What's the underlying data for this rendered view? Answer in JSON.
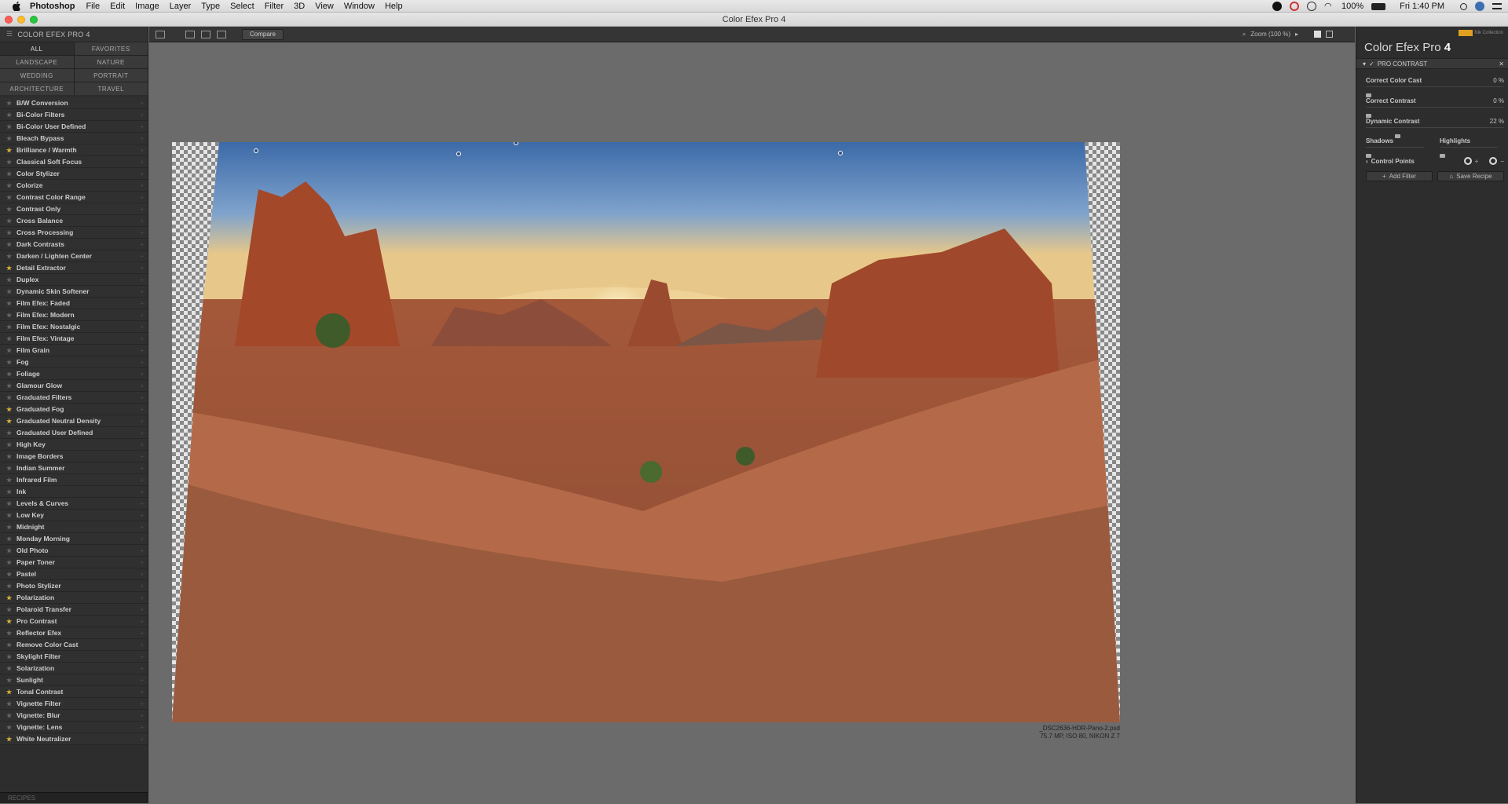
{
  "menubar": {
    "app_name": "Photoshop",
    "items": [
      "File",
      "Edit",
      "Image",
      "Layer",
      "Type",
      "Select",
      "Filter",
      "3D",
      "View",
      "Window",
      "Help"
    ],
    "battery": "100%",
    "clock": "Fri 1:40 PM"
  },
  "window": {
    "title": "Color Efex Pro 4"
  },
  "left_panel": {
    "title": "COLOR EFEX PRO 4",
    "categories": [
      "ALL",
      "FAVORITES",
      "LANDSCAPE",
      "NATURE",
      "WEDDING",
      "PORTRAIT",
      "ARCHITECTURE",
      "TRAVEL"
    ],
    "filters": [
      {
        "name": "B/W Conversion",
        "fav": false
      },
      {
        "name": "Bi-Color Filters",
        "fav": false
      },
      {
        "name": "Bi-Color User Defined",
        "fav": false
      },
      {
        "name": "Bleach Bypass",
        "fav": false
      },
      {
        "name": "Brilliance / Warmth",
        "fav": true
      },
      {
        "name": "Classical Soft Focus",
        "fav": false
      },
      {
        "name": "Color Stylizer",
        "fav": false
      },
      {
        "name": "Colorize",
        "fav": false
      },
      {
        "name": "Contrast Color Range",
        "fav": false
      },
      {
        "name": "Contrast Only",
        "fav": false
      },
      {
        "name": "Cross Balance",
        "fav": false
      },
      {
        "name": "Cross Processing",
        "fav": false
      },
      {
        "name": "Dark Contrasts",
        "fav": false
      },
      {
        "name": "Darken / Lighten Center",
        "fav": false
      },
      {
        "name": "Detail Extractor",
        "fav": true
      },
      {
        "name": "Duplex",
        "fav": false
      },
      {
        "name": "Dynamic Skin Softener",
        "fav": false
      },
      {
        "name": "Film Efex: Faded",
        "fav": false
      },
      {
        "name": "Film Efex: Modern",
        "fav": false
      },
      {
        "name": "Film Efex: Nostalgic",
        "fav": false
      },
      {
        "name": "Film Efex: Vintage",
        "fav": false
      },
      {
        "name": "Film Grain",
        "fav": false
      },
      {
        "name": "Fog",
        "fav": false
      },
      {
        "name": "Foliage",
        "fav": false
      },
      {
        "name": "Glamour Glow",
        "fav": false
      },
      {
        "name": "Graduated Filters",
        "fav": false
      },
      {
        "name": "Graduated Fog",
        "fav": true
      },
      {
        "name": "Graduated Neutral Density",
        "fav": true
      },
      {
        "name": "Graduated User Defined",
        "fav": false
      },
      {
        "name": "High Key",
        "fav": false
      },
      {
        "name": "Image Borders",
        "fav": false
      },
      {
        "name": "Indian Summer",
        "fav": false
      },
      {
        "name": "Infrared Film",
        "fav": false
      },
      {
        "name": "Ink",
        "fav": false
      },
      {
        "name": "Levels & Curves",
        "fav": false
      },
      {
        "name": "Low Key",
        "fav": false
      },
      {
        "name": "Midnight",
        "fav": false
      },
      {
        "name": "Monday Morning",
        "fav": false
      },
      {
        "name": "Old Photo",
        "fav": false
      },
      {
        "name": "Paper Toner",
        "fav": false
      },
      {
        "name": "Pastel",
        "fav": false
      },
      {
        "name": "Photo Stylizer",
        "fav": false
      },
      {
        "name": "Polarization",
        "fav": true
      },
      {
        "name": "Polaroid Transfer",
        "fav": false
      },
      {
        "name": "Pro Contrast",
        "fav": true
      },
      {
        "name": "Reflector Efex",
        "fav": false
      },
      {
        "name": "Remove Color Cast",
        "fav": false
      },
      {
        "name": "Skylight Filter",
        "fav": false
      },
      {
        "name": "Solarization",
        "fav": false
      },
      {
        "name": "Sunlight",
        "fav": false
      },
      {
        "name": "Tonal Contrast",
        "fav": true
      },
      {
        "name": "Vignette Filter",
        "fav": false
      },
      {
        "name": "Vignette: Blur",
        "fav": false
      },
      {
        "name": "Vignette: Lens",
        "fav": false
      },
      {
        "name": "White Neutralizer",
        "fav": true
      }
    ],
    "footer": "RECIPES"
  },
  "toolbar": {
    "compare_label": "Compare",
    "zoom_label": "Zoom (100 %)"
  },
  "image": {
    "filename": "_DSC2636-HDR-Pano-2.psd",
    "meta": "75.7 MP, ISO 80, NIKON Z 7"
  },
  "right_panel": {
    "brand_prefix": "Color Efex Pro",
    "brand_number": "4",
    "logo_text": "Nik Collection",
    "section_title": "PRO CONTRAST",
    "sliders": [
      {
        "label": "Correct Color Cast",
        "value": "0 %",
        "level": 0
      },
      {
        "label": "Correct Contrast",
        "value": "0 %",
        "level": 0
      },
      {
        "label": "Dynamic Contrast",
        "value": "22 %",
        "level": 22
      }
    ],
    "shadows_label": "Shadows",
    "highlights_label": "Highlights",
    "control_points_label": "Control Points",
    "add_filter_label": "Add Filter",
    "save_recipe_label": "Save Recipe"
  }
}
